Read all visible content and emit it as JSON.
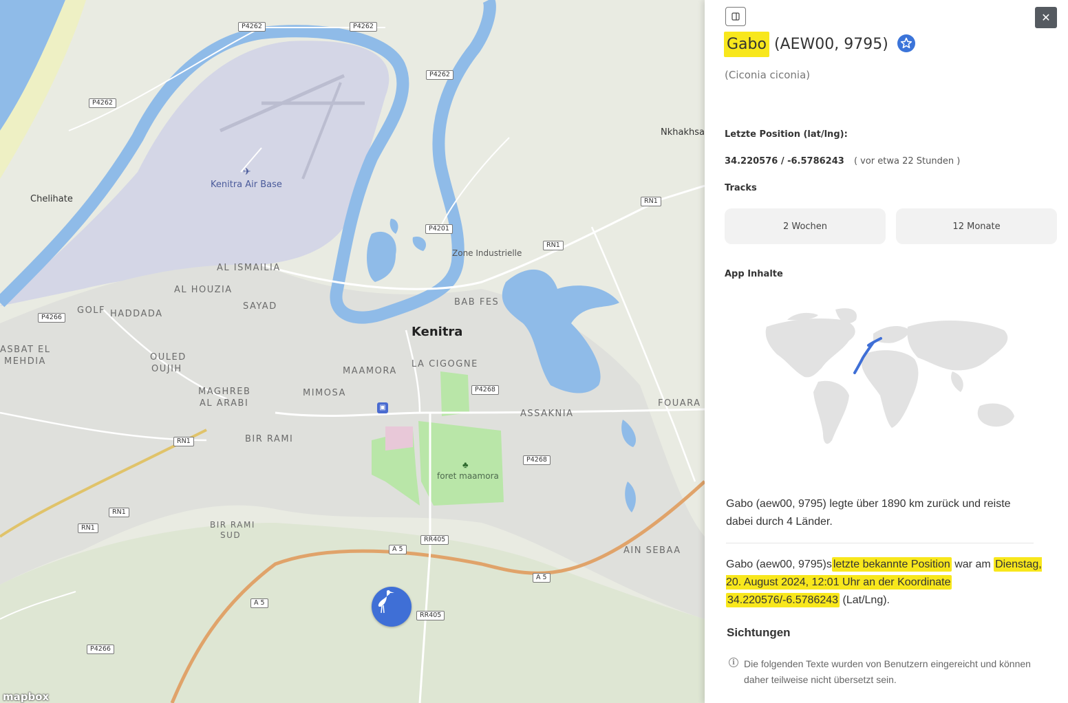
{
  "map": {
    "labels": {
      "kenitra": "Kenitra",
      "air_base": "Kenitra Air Base",
      "chelihate": "Chelihate",
      "nkhakhsa": "Nkhakhsa",
      "zone_industrielle": "Zone Industrielle",
      "al_ismailia": "AL ISMAILIA",
      "al_houzia": "AL HOUZIA",
      "sayad": "SAYAD",
      "golf": "GOLF",
      "haddada": "HADDADA",
      "kasbat": "ASBAT EL",
      "mehdia": "MEHDIA",
      "ouled": "OULED",
      "oujih": "OUJIH",
      "maghreb": "MAGHREB",
      "al_arabi": "AL ARABI",
      "mimosa": "MIMOSA",
      "maamora": "MAAMORA",
      "la_cigogne": "LA CIGOGNE",
      "bab_fes": "BAB FES",
      "bir_rami": "BIR RAMI",
      "bir_rami_sud_1": "BIR RAMI",
      "bir_rami_sud_2": "SUD",
      "assaknia": "ASSAKNIA",
      "fouarat": "FOUARA",
      "ain_sebaa": "AIN SEBAA",
      "foret": "foret maamora"
    },
    "shields": {
      "p4262_a": "P4262",
      "p4262_b": "P4262",
      "p4262_c": "P4262",
      "p4262_d": "P4262",
      "p4201": "P4201",
      "rn1_a": "RN1",
      "rn1_b": "RN1",
      "rn1_c": "RN1",
      "rn1_d": "RN1",
      "rn1_e": "RN1",
      "p4266_a": "P4266",
      "p4266_b": "P4266",
      "p4268_a": "P4268",
      "p4268_b": "P4268",
      "rr405_a": "RR405",
      "rr405_b": "RR405",
      "a5_a": "A 5",
      "a5_b": "A 5",
      "a5_c": "A 5"
    },
    "attribution": "mapbox",
    "colors": {
      "water": "#8fbbe8",
      "land": "#e9ebe2",
      "urban": "#dcdcdc",
      "park": "#b9e6a8",
      "airbase": "#d4d6e6",
      "marker": "#3f6fd6"
    }
  },
  "panel": {
    "title_name": "Gabo",
    "title_ids": "(AEW00, 9795)",
    "species": "(Ciconia ciconia)",
    "last_position_label": "Letzte Position (lat/lng):",
    "coordinates": "34.220576 / -6.5786243",
    "time_ago": "( vor etwa 22 Stunden )",
    "tracks_label": "Tracks",
    "track_buttons": [
      "2 Wochen",
      "12 Monate"
    ],
    "app_content_label": "App Inhalte",
    "summary": "Gabo (aew00, 9795) legte über 1890 km zurück und reiste dabei durch 4 Länder.",
    "last_known": {
      "part1": "Gabo (aew00, 9795)s",
      "part2": "letzte bekannte Position",
      "part3": "war am",
      "part4": "Dienstag, 20. August 2024, 12:01 Uhr an der Koordinate",
      "part5": "34.220576/-6.5786243",
      "part6": "(Lat/Lng)."
    },
    "sightings_title": "Sichtungen",
    "disclaimer": "Die folgenden Texte wurden von Benutzern eingereicht und können daher teilweise nicht übersetzt sein.",
    "close_label": "✕",
    "highlight_color": "#f8e71c"
  }
}
